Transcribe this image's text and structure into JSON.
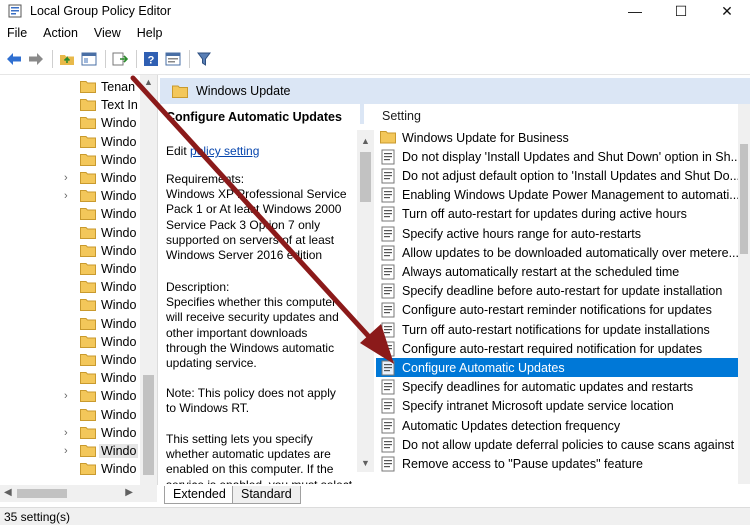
{
  "window": {
    "title": "Local Group Policy Editor",
    "minimize_glyph": "—",
    "maximize_glyph": "☐",
    "close_glyph": "✕"
  },
  "menu": [
    "File",
    "Action",
    "View",
    "Help"
  ],
  "toolbar": {
    "icons": [
      "back-arrow-icon",
      "forward-arrow-icon",
      "up-folder-icon",
      "show-hide-tree-icon",
      "export-list-icon",
      "help-icon",
      "properties-icon",
      "filter-icon"
    ]
  },
  "tree": {
    "items": [
      {
        "label": "Tenan",
        "expandable": false
      },
      {
        "label": "Text In",
        "expandable": false
      },
      {
        "label": "Windo",
        "expandable": false
      },
      {
        "label": "Windo",
        "expandable": false
      },
      {
        "label": "Windo",
        "expandable": false
      },
      {
        "label": "Windo",
        "expandable": true
      },
      {
        "label": "Windo",
        "expandable": true
      },
      {
        "label": "Windo",
        "expandable": false
      },
      {
        "label": "Windo",
        "expandable": false
      },
      {
        "label": "Windo",
        "expandable": false
      },
      {
        "label": "Windo",
        "expandable": false
      },
      {
        "label": "Windo",
        "expandable": false
      },
      {
        "label": "Windo",
        "expandable": false
      },
      {
        "label": "Windo",
        "expandable": false
      },
      {
        "label": "Windo",
        "expandable": false
      },
      {
        "label": "Windo",
        "expandable": false
      },
      {
        "label": "Windo",
        "expandable": false
      },
      {
        "label": "Windo",
        "expandable": true
      },
      {
        "label": "Windo",
        "expandable": false
      },
      {
        "label": "Windo",
        "expandable": true
      },
      {
        "label": "Windo",
        "expandable": true,
        "selected": true
      },
      {
        "label": "Windo",
        "expandable": false
      }
    ]
  },
  "header": {
    "title": "Windows Update"
  },
  "description": {
    "title": "Configure Automatic Updates",
    "edit_prefix": "Edit ",
    "edit_link": "policy setting",
    "requirements": "Requirements:\nWindows XP Professional Service\nPack 1 or At least Windows 2000\nService Pack 3 Option 7 only\nsupported on servers of at least\nWindows Server 2016 edition",
    "description_text": "Description:\nSpecifies whether this computer\nwill receive security updates and\nother important downloads\nthrough the Windows automatic\nupdating service.",
    "note": "Note: This policy does not apply\nto Windows RT.",
    "more": "This setting lets you specify\nwhether automatic updates are\nenabled on this computer. If the\nservice is enabled, you must select"
  },
  "settings": {
    "column_header": "Setting",
    "rows": [
      {
        "label": "Windows Update for Business",
        "kind": "folder"
      },
      {
        "label": "Do not display 'Install Updates and Shut Down' option in Sh...",
        "kind": "policy"
      },
      {
        "label": "Do not adjust default option to 'Install Updates and Shut Do...",
        "kind": "policy"
      },
      {
        "label": "Enabling Windows Update Power Management to automati...",
        "kind": "policy"
      },
      {
        "label": "Turn off auto-restart for updates during active hours",
        "kind": "policy"
      },
      {
        "label": "Specify active hours range for auto-restarts",
        "kind": "policy"
      },
      {
        "label": "Allow updates to be downloaded automatically over metere...",
        "kind": "policy"
      },
      {
        "label": "Always automatically restart at the scheduled time",
        "kind": "policy"
      },
      {
        "label": "Specify deadline before auto-restart for update installation",
        "kind": "policy"
      },
      {
        "label": "Configure auto-restart reminder notifications for updates",
        "kind": "policy"
      },
      {
        "label": "Turn off auto-restart notifications for update installations",
        "kind": "policy"
      },
      {
        "label": "Configure auto-restart required notification for updates",
        "kind": "policy"
      },
      {
        "label": "Configure Automatic Updates",
        "kind": "policy",
        "selected": true
      },
      {
        "label": "Specify deadlines for automatic updates and restarts",
        "kind": "policy"
      },
      {
        "label": "Specify intranet Microsoft update service location",
        "kind": "policy"
      },
      {
        "label": "Automatic Updates detection frequency",
        "kind": "policy"
      },
      {
        "label": "Do not allow update deferral policies to cause scans against ...",
        "kind": "policy"
      },
      {
        "label": "Remove access to \"Pause updates\" feature",
        "kind": "policy"
      }
    ]
  },
  "tabs": [
    {
      "label": "Extended",
      "active": true
    },
    {
      "label": "Standard",
      "active": false
    }
  ],
  "status": {
    "text": "35 setting(s)"
  },
  "colors": {
    "selection": "#0078d7",
    "header_band": "#dbe6f5",
    "annotation_arrow": "#8b1a1a",
    "link": "#0645ad"
  }
}
